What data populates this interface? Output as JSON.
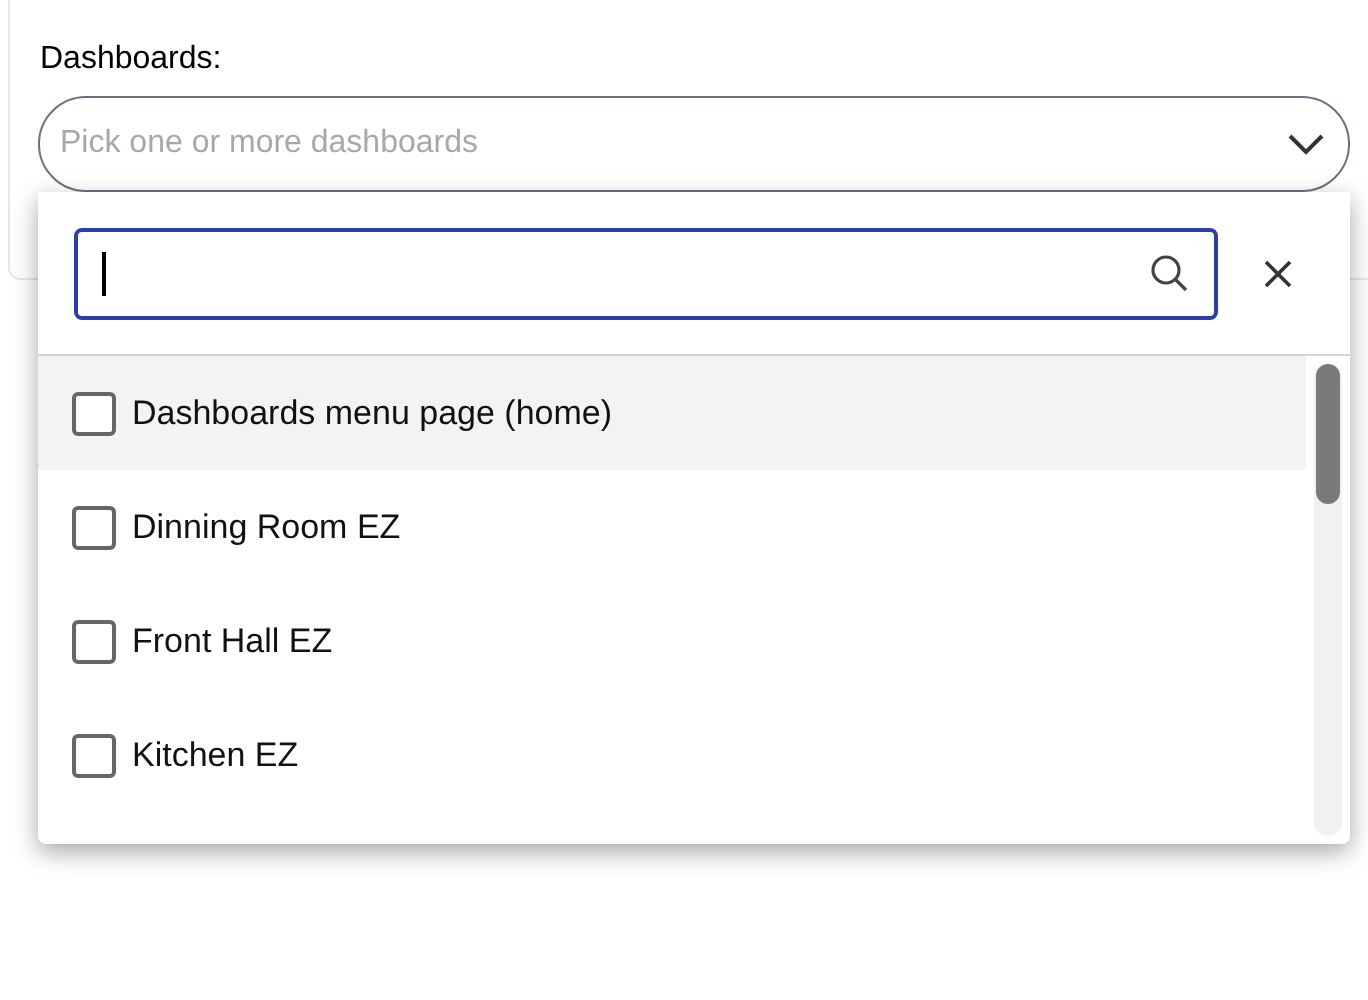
{
  "field": {
    "label": "Dashboards:",
    "placeholder": "Pick one or more dashboards"
  },
  "dropdown": {
    "options": [
      {
        "label": "Dashboards menu page (home)",
        "checked": false,
        "highlighted": true
      },
      {
        "label": "Dinning Room EZ",
        "checked": false,
        "highlighted": false
      },
      {
        "label": "Front Hall EZ",
        "checked": false,
        "highlighted": false
      },
      {
        "label": "Kitchen EZ",
        "checked": false,
        "highlighted": false
      }
    ]
  }
}
